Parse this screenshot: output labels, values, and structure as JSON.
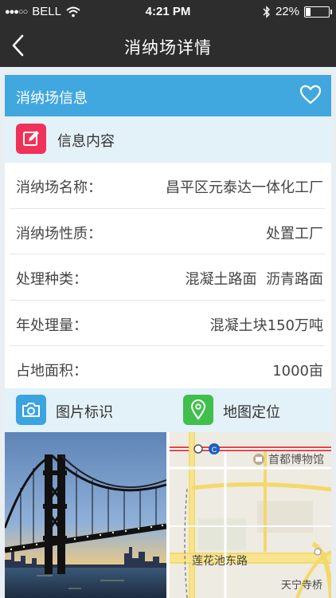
{
  "status_bar": {
    "carrier": "BELL",
    "time": "4:21 PM",
    "battery_percent": "22%",
    "battery_level": 0.22
  },
  "nav": {
    "title": "消纳场详情",
    "back_icon": "chevron-left-icon"
  },
  "card": {
    "header_label": "消纳场信息",
    "favorite_icon": "heart-icon",
    "info_section_label": "信息内容",
    "info_icon": "edit-icon",
    "rows": [
      {
        "key": "消纳场名称：",
        "value": "昌平区元泰达一体化工厂"
      },
      {
        "key": "消纳场性质：",
        "value": "处置工厂"
      },
      {
        "key": "处理种类：",
        "value": "混凝土路面  沥青路面"
      },
      {
        "key": "年处理量：",
        "value": "混凝土块150万吨"
      },
      {
        "key": "占地面积：",
        "value": "1000亩"
      }
    ],
    "photo_section_label": "图片标识",
    "photo_icon": "camera-icon",
    "map_section_label": "地图定位",
    "map_icon": "location-pin-icon",
    "map_labels": {
      "museum": "首都博物馆",
      "road": "莲花池东路",
      "temple": "天宁寺桥"
    }
  },
  "colors": {
    "nav_bg": "#2d2d2d",
    "header_blue": "#41a7df",
    "section_bg": "#e3f1f8",
    "info_icon_bg": "#f0325a",
    "photo_icon_bg": "#3ba4e0",
    "map_icon_bg": "#3fc04c"
  }
}
